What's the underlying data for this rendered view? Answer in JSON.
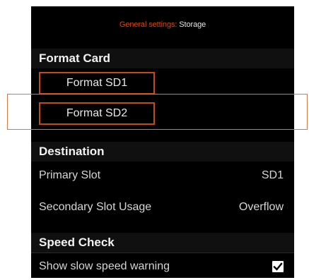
{
  "header": {
    "category": "General settings",
    "separator": ":",
    "page": "Storage"
  },
  "format_card": {
    "title": "Format Card",
    "buttons": [
      "Format SD1",
      "Format SD2"
    ],
    "focused_index": 1
  },
  "destination": {
    "title": "Destination",
    "rows": [
      {
        "label": "Primary Slot",
        "value": "SD1"
      },
      {
        "label": "Secondary Slot Usage",
        "value": "Overflow"
      }
    ]
  },
  "speed_check": {
    "title": "Speed Check",
    "rows": [
      {
        "label": "Show slow speed warning",
        "checked": true
      }
    ]
  },
  "colors": {
    "accent": "#d8480e",
    "focus_border": "#d07a44",
    "background": "#000000"
  }
}
